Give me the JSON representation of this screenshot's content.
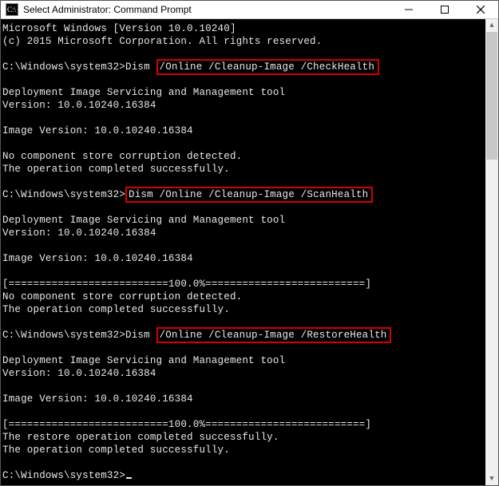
{
  "window": {
    "title": "Select Administrator: Command Prompt"
  },
  "lines": {
    "l1": "Microsoft Windows [Version 10.0.10240]",
    "l2": "(c) 2015 Microsoft Corporation. All rights reserved.",
    "p1_prefix": "C:\\Windows\\system32>Dism ",
    "p1_hl": "/Online /Cleanup-Image /CheckHealth",
    "tool": "Deployment Image Servicing and Management tool",
    "ver": "Version: 10.0.10240.16384",
    "imgver": "Image Version: 10.0.10240.16384",
    "nocorr": "No component store corruption detected.",
    "opok": "The operation completed successfully.",
    "p2_prefix": "C:\\Windows\\system32>",
    "p2_hl": "Dism /Online /Cleanup-Image /ScanHealth",
    "progress": "[==========================100.0%==========================]",
    "p3_prefix": "C:\\Windows\\system32>Dism ",
    "p3_hl": "/Online /Cleanup-Image /RestoreHealth",
    "restoreok": "The restore operation completed successfully.",
    "final_prompt": "C:\\Windows\\system32>"
  }
}
